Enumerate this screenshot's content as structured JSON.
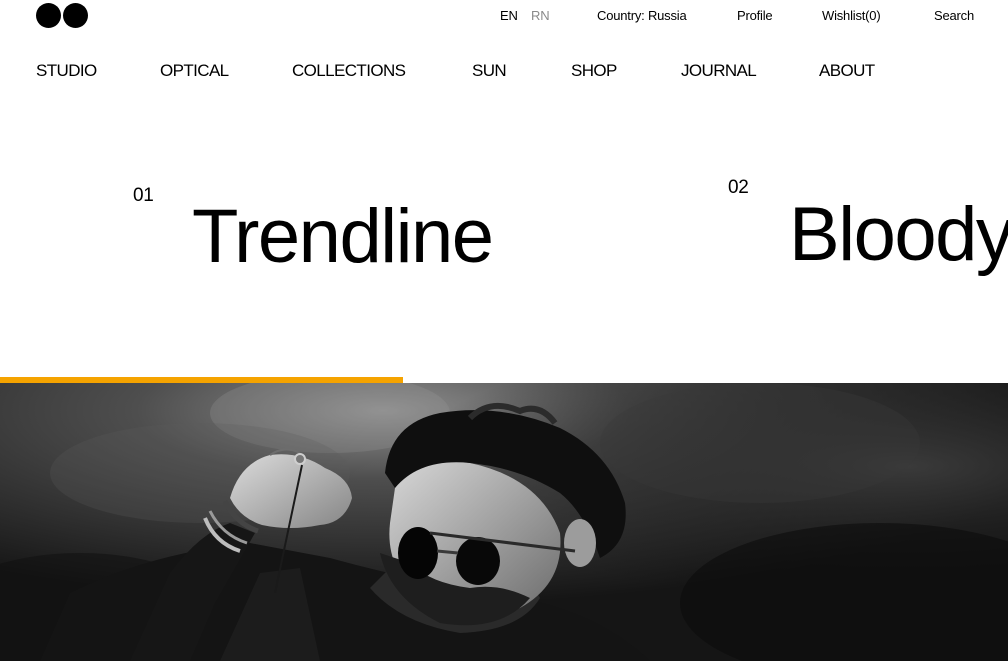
{
  "logo": {
    "icon": "two-black-dots-logo"
  },
  "topbar": {
    "lang_en": "EN",
    "lang_rn": "RN",
    "country": "Country: Russia",
    "profile": "Profile",
    "wishlist": "Wishlist(0)",
    "search": "Search"
  },
  "nav": {
    "items": [
      {
        "label": "STUDIO"
      },
      {
        "label": "OPTICAL"
      },
      {
        "label": "COLLECTIONS"
      },
      {
        "label": "SUN"
      },
      {
        "label": "SHOP"
      },
      {
        "label": "JOURNAL"
      },
      {
        "label": "ABOUT"
      }
    ]
  },
  "slider": {
    "items": [
      {
        "num": "01",
        "title": "Trendline"
      },
      {
        "num": "02",
        "title": "Bloody"
      }
    ],
    "progress_fraction": 0.4,
    "progress_color": "#f5a300"
  },
  "hero": {
    "image": "black-and-white-man-sunglasses-photo"
  },
  "colors": {
    "accent": "#f5a300",
    "text": "#000000",
    "muted": "#8a8a8a"
  }
}
